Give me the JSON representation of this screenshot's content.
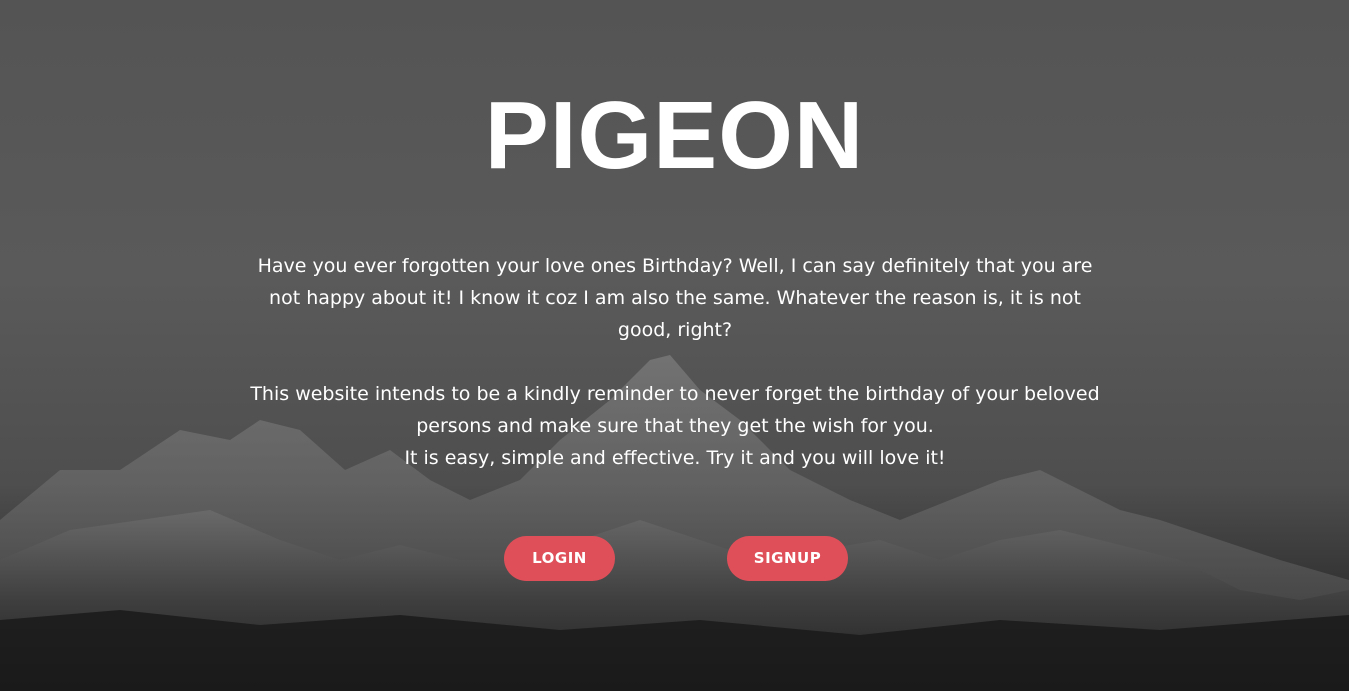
{
  "hero": {
    "title": "PIGEON",
    "paragraph1": "Have you ever forgotten your love ones Birthday? Well, I can say definitely that you are not happy about it! I know it coz I am also the same. Whatever the reason is, it is not good, right?",
    "paragraph2_line1": "This website intends to be a kindly reminder to never forget the birthday of  your beloved persons and make sure that they get the wish for you.",
    "paragraph2_line2": "It is easy, simple and effective. Try it and you will love it!"
  },
  "buttons": {
    "login_label": "LOGIN",
    "signup_label": "SIGNUP"
  },
  "colors": {
    "accent": "#df4f59",
    "text": "#ffffff",
    "background": "#555555"
  }
}
